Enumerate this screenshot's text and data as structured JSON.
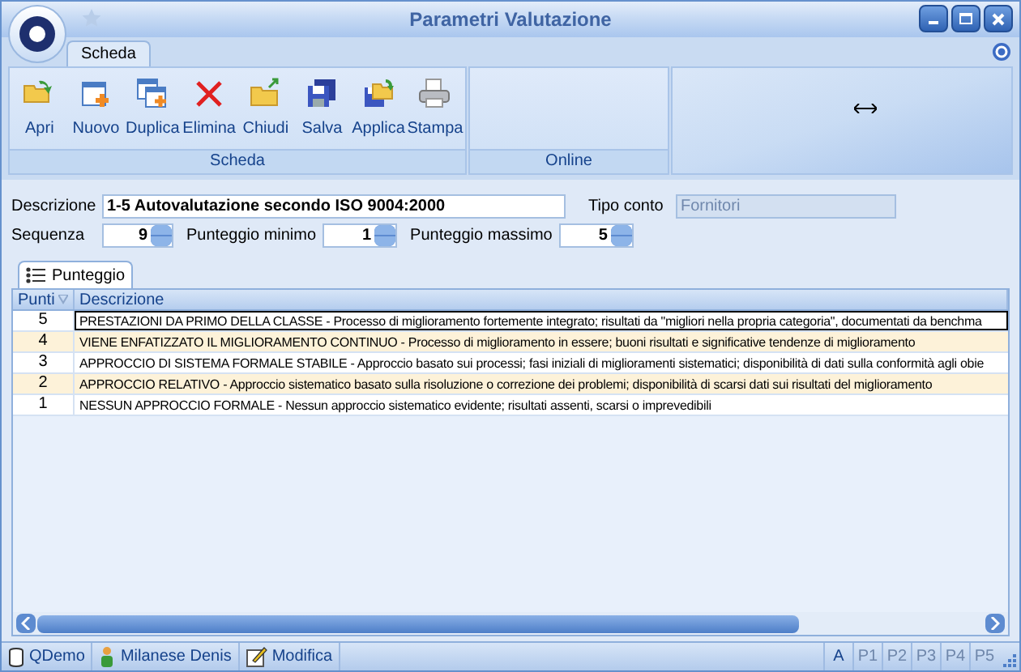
{
  "window": {
    "title": "Parametri Valutazione"
  },
  "ribbon_tabs": [
    {
      "label": "Scheda",
      "selected": true
    }
  ],
  "ribbon_groups": [
    {
      "label": "Scheda",
      "buttons": [
        {
          "label": "Apri",
          "kind": "open"
        },
        {
          "label": "Nuovo",
          "kind": "new"
        },
        {
          "label": "Duplica",
          "kind": "duplicate"
        },
        {
          "label": "Elimina",
          "kind": "delete"
        },
        {
          "label": "Chiudi",
          "kind": "close"
        },
        {
          "label": "Salva",
          "kind": "save"
        },
        {
          "label": "Applica",
          "kind": "apply"
        },
        {
          "label": "Stampa",
          "kind": "print"
        }
      ]
    },
    {
      "label": "Online"
    }
  ],
  "form": {
    "descrizione_label": "Descrizione",
    "descrizione": "1-5 Autovalutazione secondo ISO 9004:2000",
    "tipo_conto_label": "Tipo conto",
    "tipo_conto": "Fornitori",
    "sequenza_label": "Sequenza",
    "sequenza": "9",
    "minimo_label": "Punteggio minimo",
    "minimo": "1",
    "massimo_label": "Punteggio massimo",
    "massimo": "5"
  },
  "tabs": [
    {
      "label": "Punteggio",
      "selected": true
    }
  ],
  "table": {
    "columns": [
      "Punti",
      "Descrizione"
    ],
    "rows": [
      {
        "punti": "5",
        "descrizione": "PRESTAZIONI DA PRIMO DELLA CLASSE - Processo di miglioramento fortemente integrato; risultati da \"migliori nella propria categoria\", documentati da benchma",
        "selected": true
      },
      {
        "punti": "4",
        "descrizione": "VIENE ENFATIZZATO IL MIGLIORAMENTO CONTINUO - Processo di miglioramento in essere; buoni risultati e significative tendenze di miglioramento",
        "selected": false
      },
      {
        "punti": "3",
        "descrizione": "APPROCCIO DI SISTEMA FORMALE STABILE - Approccio basato sui processi; fasi iniziali di miglioramenti sistematici; disponibilità di dati sulla conformità agli obie",
        "selected": false
      },
      {
        "punti": "2",
        "descrizione": "APPROCCIO RELATIVO - Approccio sistematico basato sulla risoluzione o correzione dei problemi; disponibilità di scarsi dati sui risultati del miglioramento",
        "selected": false
      },
      {
        "punti": "1",
        "descrizione": "NESSUN APPROCCIO FORMALE - Nessun approccio sistematico evidente; risultati assenti, scarsi o imprevedibili",
        "selected": false
      }
    ]
  },
  "status_bar": {
    "items": [
      {
        "label": "QDemo",
        "kind": "database"
      },
      {
        "label": "Milanese Denis",
        "kind": "user"
      },
      {
        "label": "Modifica",
        "kind": "edit"
      }
    ],
    "keys": [
      {
        "label": "A",
        "disabled": false
      },
      {
        "label": "P1",
        "disabled": true
      },
      {
        "label": "P2",
        "disabled": true
      },
      {
        "label": "P3",
        "disabled": true
      },
      {
        "label": "P4",
        "disabled": true
      },
      {
        "label": "P5",
        "disabled": true
      }
    ]
  }
}
